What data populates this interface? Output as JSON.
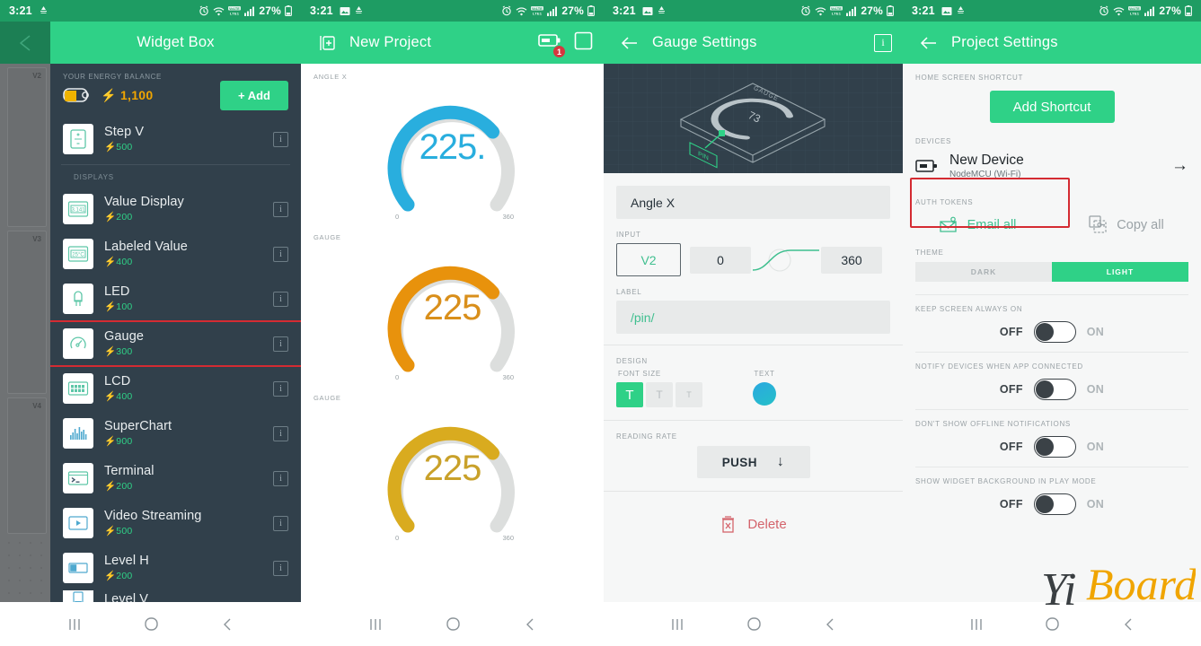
{
  "status_bar": {
    "time": "3:21",
    "battery_percent": "27%",
    "icons": [
      "image-icon",
      "data-rate-icon",
      "alarm-icon",
      "wifi-icon",
      "volte-icon",
      "signal-icon",
      "battery-icon"
    ]
  },
  "colors": {
    "accent_green": "#2fd187",
    "status_green": "#1e9c63",
    "dark_panel": "#31404b",
    "coin_gold": "#f0a500",
    "highlight_red": "#d42b32",
    "gauge_blue": "#29aede",
    "gauge_orange": "#e8920c",
    "gauge_yellow": "#d9ab1f",
    "gauge_track": "#dcdedd"
  },
  "panel1": {
    "title": "Widget Box",
    "back_icon": "back-triangle-icon",
    "energy": {
      "label": "YOUR ENERGY BALANCE",
      "value": "1,100",
      "coin": "⚡",
      "add_label": "+ Add"
    },
    "partial_top_item": {
      "name": "Step V",
      "cost": "500",
      "icon": "stepper-icon"
    },
    "section_header": "DISPLAYS",
    "items": [
      {
        "name": "Value Display",
        "cost": "200",
        "icon": "value-display-icon",
        "icon_text": "3.141",
        "selected": false
      },
      {
        "name": "Labeled Value",
        "cost": "400",
        "icon": "labeled-value-icon",
        "icon_text": "25°C",
        "selected": false
      },
      {
        "name": "LED",
        "cost": "100",
        "icon": "led-icon",
        "icon_text": "",
        "selected": false
      },
      {
        "name": "Gauge",
        "cost": "300",
        "icon": "gauge-icon",
        "icon_text": "",
        "selected": true
      },
      {
        "name": "LCD",
        "cost": "400",
        "icon": "lcd-icon",
        "icon_text": "",
        "selected": false
      },
      {
        "name": "SuperChart",
        "cost": "900",
        "icon": "superchart-icon",
        "icon_text": "",
        "selected": false
      },
      {
        "name": "Terminal",
        "cost": "200",
        "icon": "terminal-icon",
        "icon_text": ">_",
        "selected": false
      },
      {
        "name": "Video Streaming",
        "cost": "500",
        "icon": "video-icon",
        "icon_text": "",
        "selected": false
      },
      {
        "name": "Level H",
        "cost": "200",
        "icon": "level-h-icon",
        "icon_text": "",
        "selected": false
      }
    ],
    "partial_bottom_item": {
      "name": "Level V",
      "cost": "",
      "icon": "level-v-icon"
    },
    "background_cards": [
      "V2",
      "V3",
      "V4"
    ],
    "info_glyph": "i"
  },
  "panel2": {
    "title": "New Project",
    "leading_icon": "project-icon",
    "play_icon": "device-icon",
    "badge_count": "1",
    "stop_icon": "stop-square-icon",
    "gauges": [
      {
        "label": "ANGLE X",
        "value": "225.",
        "min": "0",
        "max": "360",
        "color": "#29aede",
        "pct": 62
      },
      {
        "label": "GAUGE",
        "value": "225",
        "min": "0",
        "max": "360",
        "color": "#e8920c",
        "pct": 62
      },
      {
        "label": "GAUGE",
        "value": "225",
        "min": "0",
        "max": "360",
        "color": "#d9ab1f",
        "pct": 62
      }
    ]
  },
  "panel3": {
    "title": "Gauge Settings",
    "back_icon": "arrow-left-icon",
    "info_icon": "info-icon",
    "hero": {
      "widget_label": "GAUGE",
      "widget_value": "73",
      "pin_tag": "PIN"
    },
    "name_field": {
      "value": "Angle X"
    },
    "input": {
      "label": "INPUT",
      "pin": "V2",
      "min": "0",
      "max": "360",
      "curve_icon": "mapping-curve-icon"
    },
    "label_field": {
      "label": "LABEL",
      "value": "/pin/"
    },
    "design": {
      "label": "DESIGN",
      "font_size_label": "FONT SIZE",
      "font_sizes": [
        "T",
        "T",
        "T"
      ],
      "selected_font_index": 0,
      "text_label": "TEXT",
      "text_color": "#29aede"
    },
    "reading_rate": {
      "label": "READING RATE",
      "value": "PUSH",
      "chevron": "↓"
    },
    "delete": {
      "label": "Delete",
      "icon": "delete-icon"
    }
  },
  "panel4": {
    "title": "Project Settings",
    "back_icon": "arrow-left-icon",
    "shortcut": {
      "label": "HOME SCREEN SHORTCUT",
      "button": "Add Shortcut"
    },
    "devices": {
      "label": "DEVICES",
      "name": "New Device",
      "subtitle": "NodeMCU (Wi-Fi)",
      "icon": "device-board-icon",
      "chevron": "→"
    },
    "auth_tokens": {
      "label": "AUTH TOKENS",
      "email_all": "Email all",
      "email_icon": "email-key-icon",
      "copy_all": "Copy all",
      "copy_icon": "copy-key-icon",
      "highlighted": true
    },
    "theme": {
      "label": "THEME",
      "options": [
        "DARK",
        "LIGHT"
      ],
      "selected": "LIGHT"
    },
    "toggles": [
      {
        "label": "KEEP SCREEN ALWAYS ON",
        "off": "OFF",
        "on": "ON",
        "state": "off"
      },
      {
        "label": "NOTIFY DEVICES WHEN APP CONNECTED",
        "off": "OFF",
        "on": "ON",
        "state": "off"
      },
      {
        "label": "DON'T SHOW OFFLINE NOTIFICATIONS",
        "off": "OFF",
        "on": "ON",
        "state": "off"
      },
      {
        "label": "SHOW WIDGET BACKGROUND IN PLAY MODE",
        "off": "OFF",
        "on": "ON",
        "state": "off"
      }
    ]
  },
  "navbar": {
    "recents": "recents-icon",
    "home": "home-icon",
    "back": "back-icon"
  },
  "watermark": {
    "text_dark": "Yi",
    "text_gold": "Board"
  }
}
